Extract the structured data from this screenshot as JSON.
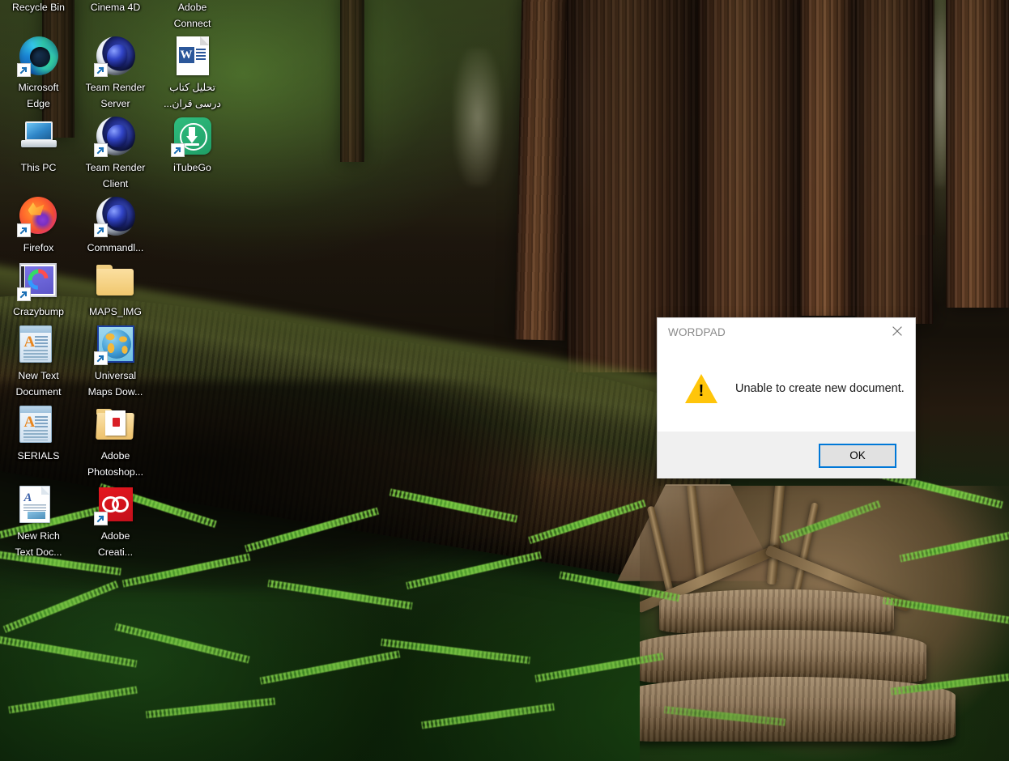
{
  "desktop": {
    "wallpaper_description": "Redwood forest with wooden stairway and ferns",
    "icons": [
      {
        "name": "Recycle Bin",
        "art": "recyclebin",
        "shortcut": false
      },
      {
        "name": "Cinema 4D",
        "art": "cinema4d",
        "shortcut": true
      },
      {
        "name": "Adobe\nConnect",
        "art": "adobeconnect",
        "shortcut": true
      },
      {
        "name": "Microsoft\nEdge",
        "art": "edge",
        "shortcut": true
      },
      {
        "name": "Team Render\nServer",
        "art": "cinema4d",
        "shortcut": true
      },
      {
        "name": "تحلیل کتاب\nدرسی قران...",
        "art": "word-doc",
        "shortcut": false,
        "rtl": true
      },
      {
        "name": "This PC",
        "art": "thispc",
        "shortcut": false
      },
      {
        "name": "Team Render\nClient",
        "art": "cinema4d",
        "shortcut": true
      },
      {
        "name": "iTubeGo",
        "art": "itubego",
        "shortcut": true
      },
      {
        "name": "Firefox",
        "art": "firefox",
        "shortcut": true
      },
      {
        "name": "Commandl...",
        "art": "cinema4d",
        "shortcut": true
      },
      {
        "name": "",
        "art": "none",
        "shortcut": false
      },
      {
        "name": "Crazybump",
        "art": "crazybump",
        "shortcut": true
      },
      {
        "name": "MAPS_IMG",
        "art": "folder",
        "shortcut": false
      },
      {
        "name": "",
        "art": "none",
        "shortcut": false
      },
      {
        "name": "New Text\nDocument",
        "art": "txtdoc",
        "shortcut": false
      },
      {
        "name": "Universal\nMaps Dow...",
        "art": "globe",
        "shortcut": true
      },
      {
        "name": "",
        "art": "none",
        "shortcut": false
      },
      {
        "name": "SERIALS",
        "art": "txtdoc",
        "shortcut": false
      },
      {
        "name": "Adobe\nPhotoshop...",
        "art": "folder-open",
        "shortcut": false
      },
      {
        "name": "",
        "art": "none",
        "shortcut": false
      },
      {
        "name": "New Rich\nText Doc...",
        "art": "rtfdoc",
        "shortcut": false
      },
      {
        "name": "Adobe\nCreati...",
        "art": "adobecc",
        "shortcut": true
      },
      {
        "name": "",
        "art": "none",
        "shortcut": false
      }
    ]
  },
  "dialog": {
    "title": "WORDPAD",
    "message": "Unable to create new document.",
    "ok_label": "OK",
    "close_icon": "close-icon",
    "warning_icon": "warning-triangle-icon",
    "warning_glyph": "!",
    "accent_color": "#0078d7",
    "warning_color": "#ffc50a",
    "title_color": "#8a8a8a",
    "footer_color": "#f0f0f0"
  }
}
